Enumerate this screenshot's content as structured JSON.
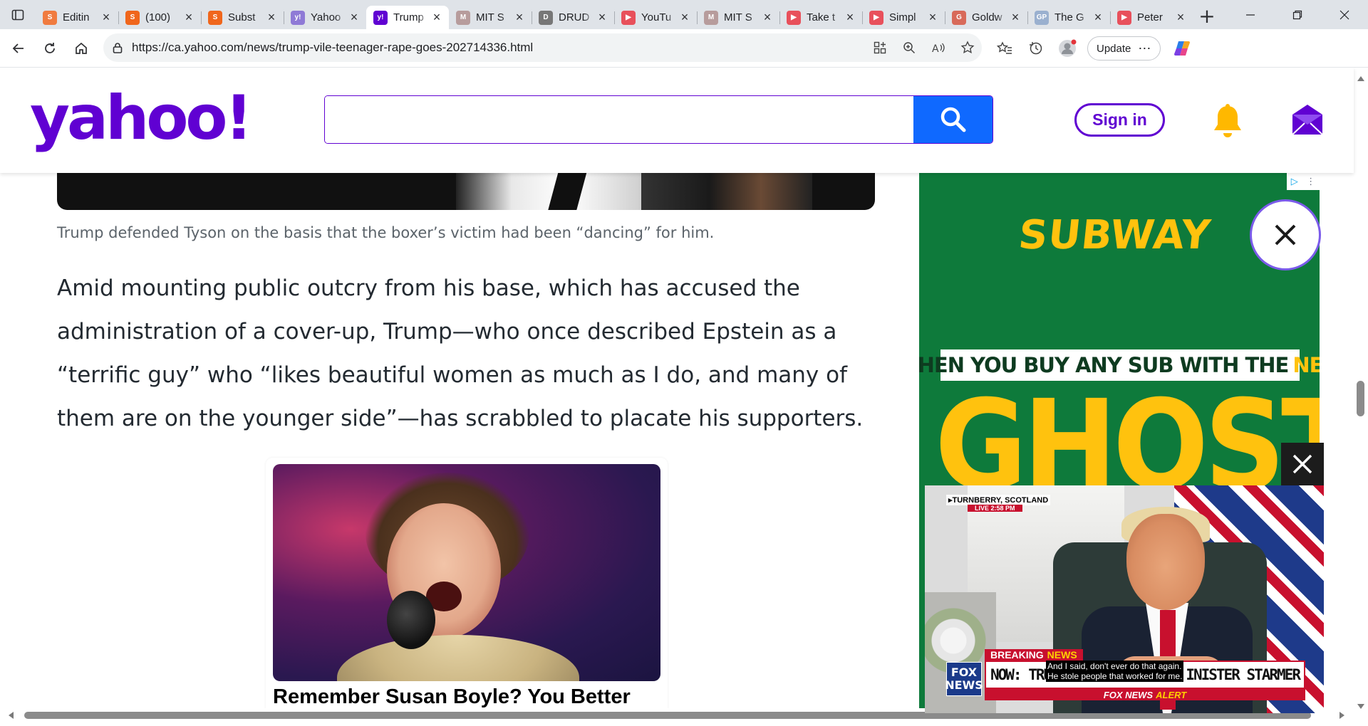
{
  "browser": {
    "tabs": [
      {
        "label": "Editin",
        "fav_color": "#f07b3f",
        "fav_glyph": "S",
        "active": false
      },
      {
        "label": "(100)",
        "fav_color": "#f0661c",
        "fav_glyph": "S",
        "active": false
      },
      {
        "label": "Subst",
        "fav_color": "#f0661c",
        "fav_glyph": "S",
        "active": false
      },
      {
        "label": "Yahoo",
        "fav_color": "#8f7ad6",
        "fav_glyph": "y!",
        "active": false
      },
      {
        "label": "Trump",
        "fav_color": "#6001d2",
        "fav_glyph": "y!",
        "active": true
      },
      {
        "label": "MIT S",
        "fav_color": "#b79c9c",
        "fav_glyph": "M",
        "active": false
      },
      {
        "label": "DRUD",
        "fav_color": "#777777",
        "fav_glyph": "D",
        "active": false
      },
      {
        "label": "YouTu",
        "fav_color": "#e8505b",
        "fav_glyph": "▶",
        "active": false
      },
      {
        "label": "MIT S",
        "fav_color": "#b79c9c",
        "fav_glyph": "M",
        "active": false
      },
      {
        "label": "Take t",
        "fav_color": "#e8505b",
        "fav_glyph": "▶",
        "active": false
      },
      {
        "label": "Simpl",
        "fav_color": "#e8505b",
        "fav_glyph": "▶",
        "active": false
      },
      {
        "label": "Goldw",
        "fav_color": "#d86a5a",
        "fav_glyph": "G",
        "active": false
      },
      {
        "label": "The G",
        "fav_color": "#9ab0cf",
        "fav_glyph": "GP",
        "active": false
      },
      {
        "label": "Peter",
        "fav_color": "#e8505b",
        "fav_glyph": "▶",
        "active": false
      }
    ],
    "url": "https://ca.yahoo.com/news/trump-vile-teenager-rape-goes-202714336.html",
    "update_label": "Update"
  },
  "yahoo": {
    "logo": "yahoo!",
    "search_placeholder": "",
    "signin_label": "Sign in",
    "brand_color": "#6001d2"
  },
  "article": {
    "caption": "Trump defended Tyson on the basis that the boxer’s victim had been “dancing” for him.",
    "paragraph": "Amid mounting public outcry from his base, which has accused the administration of a cover-up, Trump—who once described Epstein as a “terrific guy” who “likes beautiful women as much as I do, and many of them are on the younger side”—has scrabbled to placate his supporters.",
    "ad_title": "Remember Susan Boyle? You Better"
  },
  "side_ad": {
    "brand": "SUBWAY",
    "banner_text": "WHEN YOU BUY ANY SUB WITH THE",
    "banner_new": "NEW",
    "headline": "GHOST"
  },
  "video": {
    "location": "▸TURNBERRY, SCOTLAND",
    "live": "LIVE  2:58 PM",
    "breaking": "BREAKING",
    "breaking_news": "NEWS",
    "lower_left": "NOW: TRU",
    "lower_right": "INISTER STARMER",
    "caption_line1": "And I said, don't ever do that again.",
    "caption_line2": "He stole people that worked for me.",
    "alert_left": "FOX NEWS",
    "alert_right": "ALERT",
    "logo_line1": "FOX",
    "logo_line2": "NEWS"
  }
}
